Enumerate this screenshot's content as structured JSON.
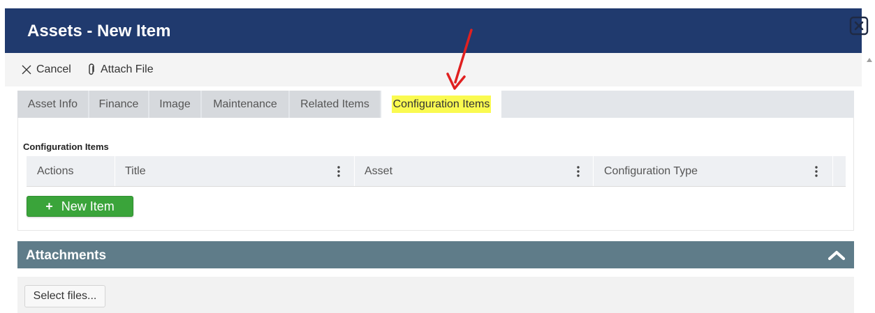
{
  "dialog": {
    "title": "Assets - New Item"
  },
  "toolbar": {
    "cancel_label": "Cancel",
    "attach_label": "Attach File"
  },
  "tabs": [
    {
      "label": "Asset Info"
    },
    {
      "label": "Finance"
    },
    {
      "label": "Image"
    },
    {
      "label": "Maintenance"
    },
    {
      "label": "Related Items"
    },
    {
      "label": "Configuration Items",
      "active": true
    }
  ],
  "config_section": {
    "label": "Configuration Items",
    "columns": [
      "Actions",
      "Title",
      "Asset",
      "Configuration Type"
    ],
    "new_button_label": "New Item"
  },
  "attachments": {
    "title": "Attachments",
    "select_label": "Select files..."
  },
  "colors": {
    "header_bg": "#203a6e",
    "highlight": "#fafa50",
    "new_button": "#3aa43a",
    "attachments_bar": "#5f7c89",
    "arrow": "#e02020"
  }
}
